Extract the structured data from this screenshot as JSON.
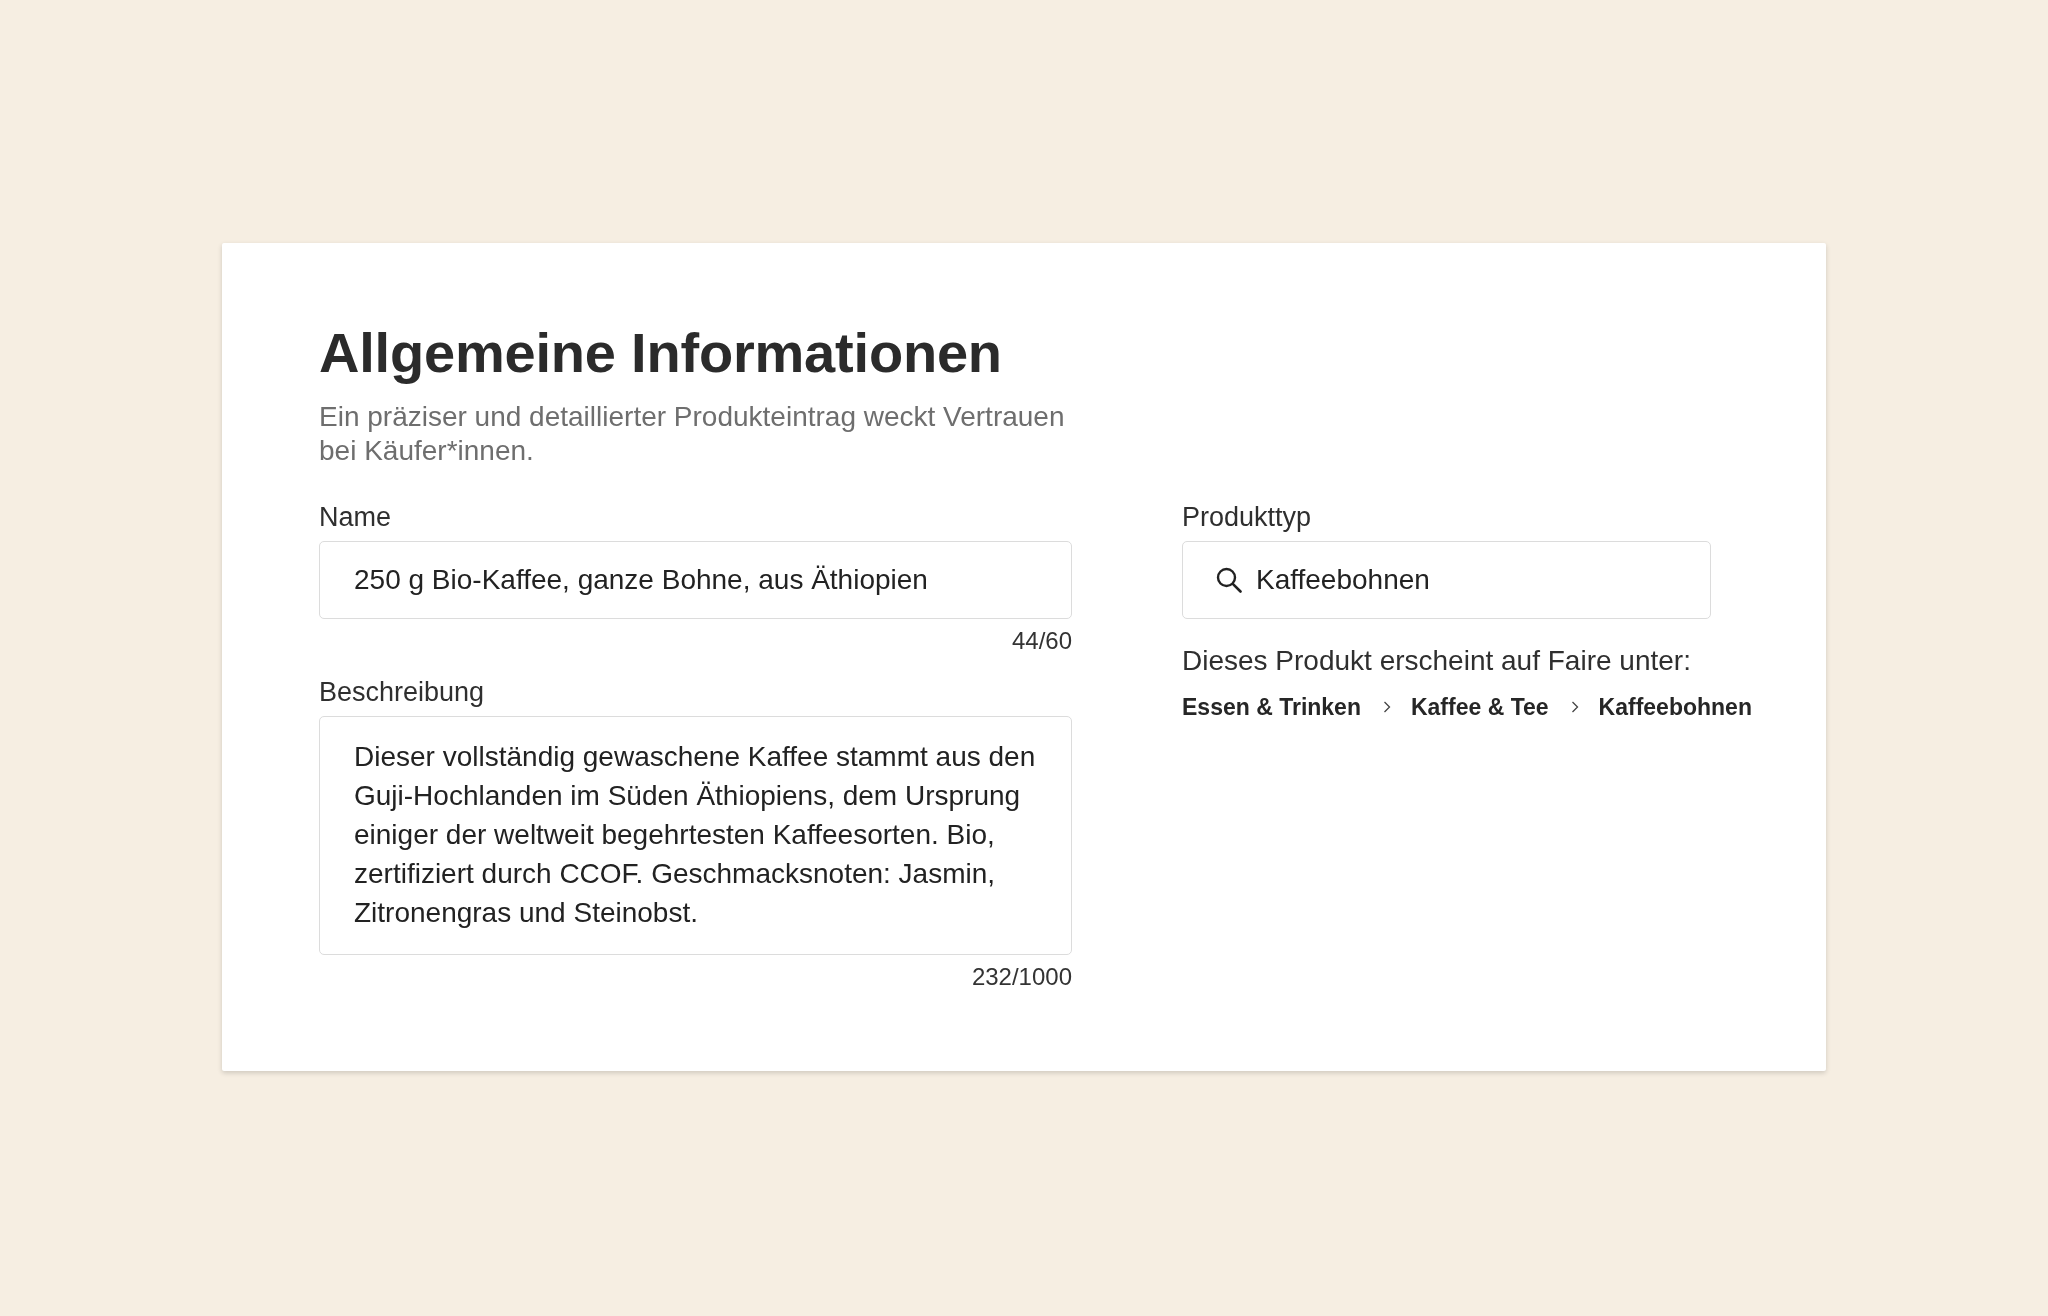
{
  "card": {
    "title": "Allgemeine Informationen",
    "subtitle": "Ein präziser und detaillierter Produkteintrag weckt Vertrauen bei Käufer*innen."
  },
  "fields": [
    {
      "kind": "text",
      "label": "Name",
      "value": "250 g Bio-Kaffee, ganze Bohne, aus Äthiopien",
      "counter": "44/60"
    },
    {
      "kind": "textarea",
      "label": "Beschreibung",
      "value": "Dieser vollständig gewaschene Kaffee stammt aus den Guji-Hochlanden im Süden Äthiopiens, dem Ursprung einiger der weltweit begehrtesten Kaffeesorten. Bio, zertifiziert durch CCOF. Geschmacksnoten: Jasmin, Zitronengras und Steinobst.",
      "counter": "232/1000"
    }
  ],
  "product_type": {
    "label": "Produkttyp",
    "value": "Kaffeebohnen",
    "note": "Dieses Produkt erscheint auf Faire unter:",
    "category_path": [
      "Essen & Trinken",
      "Kaffee & Tee",
      "Kaffeebohnen"
    ]
  }
}
